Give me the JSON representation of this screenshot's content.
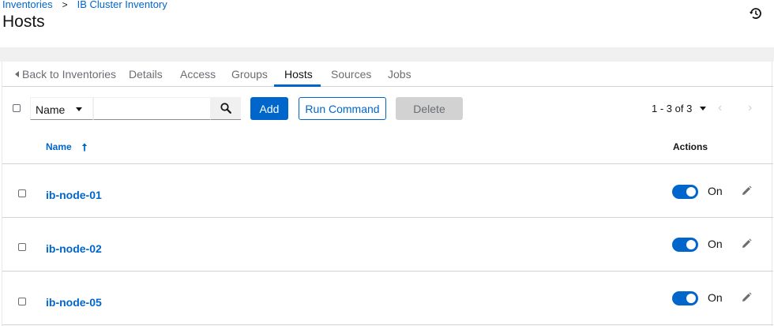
{
  "breadcrumb": {
    "items": [
      "Inventories",
      "IB Cluster Inventory"
    ],
    "separator": ">"
  },
  "page": {
    "title": "Hosts"
  },
  "tabs": [
    {
      "label": "Back to Inventories",
      "active": false
    },
    {
      "label": "Details",
      "active": false
    },
    {
      "label": "Access",
      "active": false
    },
    {
      "label": "Groups",
      "active": false
    },
    {
      "label": "Hosts",
      "active": true
    },
    {
      "label": "Sources",
      "active": false
    },
    {
      "label": "Jobs",
      "active": false
    }
  ],
  "toolbar": {
    "filter_select": "Name",
    "search_value": "",
    "add_label": "Add",
    "run_command_label": "Run Command",
    "delete_label": "Delete",
    "pagination_text": "1 - 3 of 3"
  },
  "table": {
    "columns": {
      "name": "Name",
      "actions": "Actions"
    },
    "rows": [
      {
        "name": "ib-node-01",
        "enabled_label": "On"
      },
      {
        "name": "ib-node-02",
        "enabled_label": "On"
      },
      {
        "name": "ib-node-05",
        "enabled_label": "On"
      }
    ]
  },
  "colors": {
    "accent": "#0066cc",
    "text": "#151515",
    "muted": "#6a6e73",
    "border": "#d2d2d2"
  }
}
